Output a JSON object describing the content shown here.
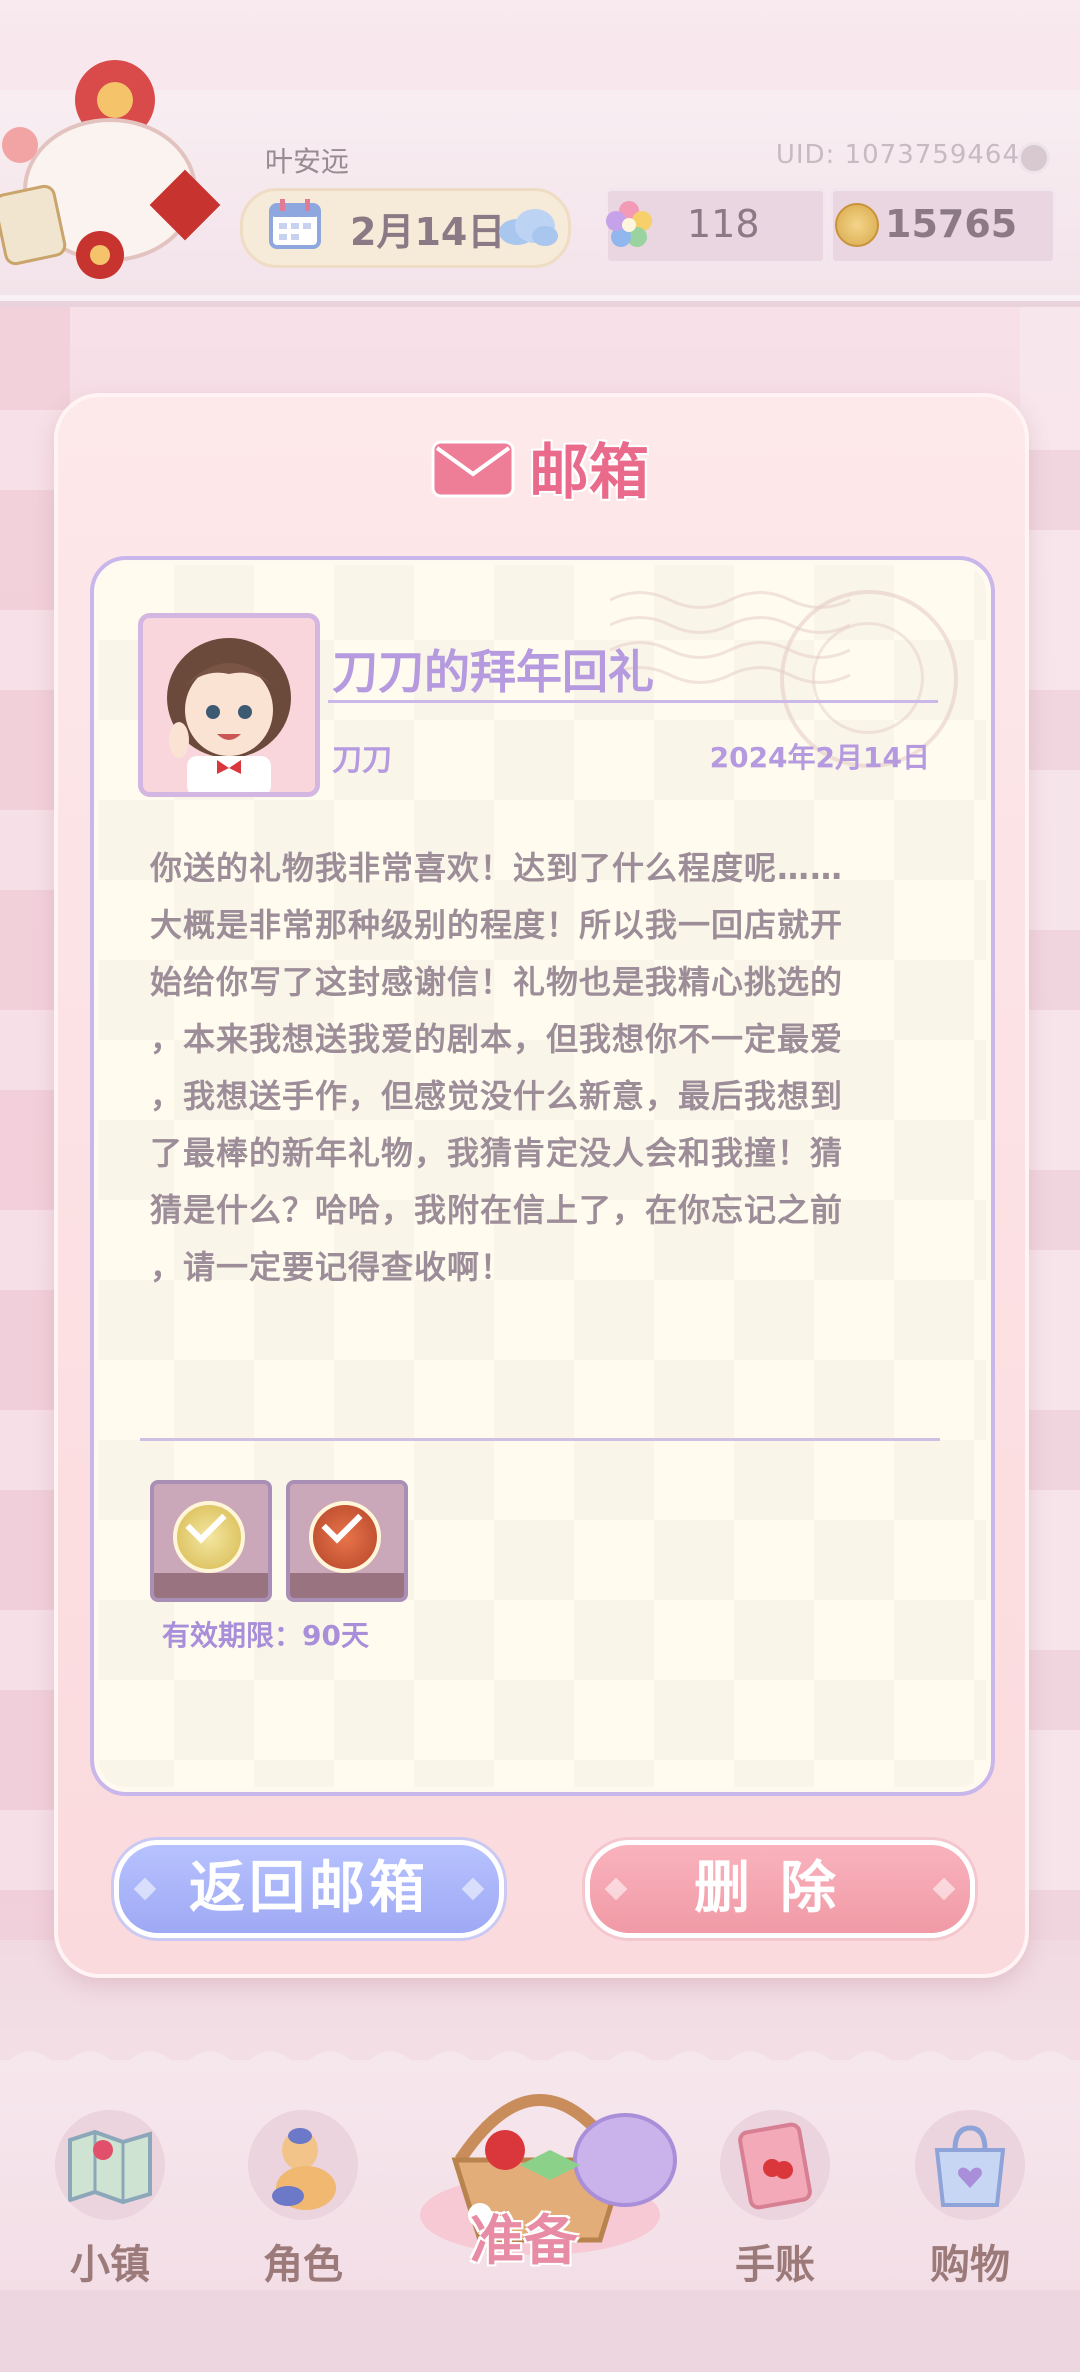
{
  "player": {
    "name": "叶安远",
    "uid": "UID: 1073759464",
    "date": "2月14日",
    "flowers": "118",
    "coins": "15765"
  },
  "dialog": {
    "title": "邮箱",
    "mail": {
      "subject": "刀刀的拜年回礼",
      "sender": "刀刀",
      "date": "2024年2月14日",
      "body_lines": [
        "你送的礼物我非常喜欢！达到了什么程度呢……",
        "大概是非常那种级别的程度！所以我一回店就开",
        "始给你写了这封感谢信！礼物也是我精心挑选的",
        "，本来我想送我爱的剧本，但我想你不一定最爱",
        "，我想送手作，但感觉没什么新意，最后我想到",
        "了最棒的新年礼物，我猜肯定没人会和我撞！猜",
        "猜是什么？哈哈，我附在信上了，在你忘记之前",
        "，请一定要记得查收啊！"
      ],
      "validity": "有效期限：90天"
    },
    "buttons": {
      "back": "返回邮箱",
      "delete": "删除"
    }
  },
  "nav": {
    "town": "小镇",
    "character": "角色",
    "prepare": "准备",
    "journal": "手账",
    "shop": "购物"
  },
  "colors": {
    "accent_title": "#e96a8a",
    "mail_purple": "#b59adf",
    "back_button": "#a8b2fa",
    "delete_button": "#f4a7b2"
  }
}
